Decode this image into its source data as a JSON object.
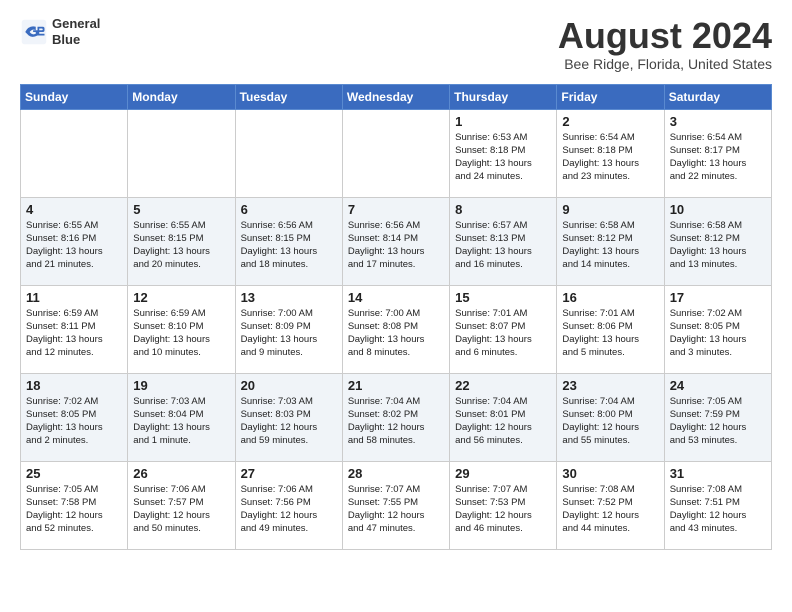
{
  "header": {
    "logo_line1": "General",
    "logo_line2": "Blue",
    "month_title": "August 2024",
    "location": "Bee Ridge, Florida, United States"
  },
  "weekdays": [
    "Sunday",
    "Monday",
    "Tuesday",
    "Wednesday",
    "Thursday",
    "Friday",
    "Saturday"
  ],
  "weeks": [
    [
      {
        "day": "",
        "info": ""
      },
      {
        "day": "",
        "info": ""
      },
      {
        "day": "",
        "info": ""
      },
      {
        "day": "",
        "info": ""
      },
      {
        "day": "1",
        "info": "Sunrise: 6:53 AM\nSunset: 8:18 PM\nDaylight: 13 hours\nand 24 minutes."
      },
      {
        "day": "2",
        "info": "Sunrise: 6:54 AM\nSunset: 8:18 PM\nDaylight: 13 hours\nand 23 minutes."
      },
      {
        "day": "3",
        "info": "Sunrise: 6:54 AM\nSunset: 8:17 PM\nDaylight: 13 hours\nand 22 minutes."
      }
    ],
    [
      {
        "day": "4",
        "info": "Sunrise: 6:55 AM\nSunset: 8:16 PM\nDaylight: 13 hours\nand 21 minutes."
      },
      {
        "day": "5",
        "info": "Sunrise: 6:55 AM\nSunset: 8:15 PM\nDaylight: 13 hours\nand 20 minutes."
      },
      {
        "day": "6",
        "info": "Sunrise: 6:56 AM\nSunset: 8:15 PM\nDaylight: 13 hours\nand 18 minutes."
      },
      {
        "day": "7",
        "info": "Sunrise: 6:56 AM\nSunset: 8:14 PM\nDaylight: 13 hours\nand 17 minutes."
      },
      {
        "day": "8",
        "info": "Sunrise: 6:57 AM\nSunset: 8:13 PM\nDaylight: 13 hours\nand 16 minutes."
      },
      {
        "day": "9",
        "info": "Sunrise: 6:58 AM\nSunset: 8:12 PM\nDaylight: 13 hours\nand 14 minutes."
      },
      {
        "day": "10",
        "info": "Sunrise: 6:58 AM\nSunset: 8:12 PM\nDaylight: 13 hours\nand 13 minutes."
      }
    ],
    [
      {
        "day": "11",
        "info": "Sunrise: 6:59 AM\nSunset: 8:11 PM\nDaylight: 13 hours\nand 12 minutes."
      },
      {
        "day": "12",
        "info": "Sunrise: 6:59 AM\nSunset: 8:10 PM\nDaylight: 13 hours\nand 10 minutes."
      },
      {
        "day": "13",
        "info": "Sunrise: 7:00 AM\nSunset: 8:09 PM\nDaylight: 13 hours\nand 9 minutes."
      },
      {
        "day": "14",
        "info": "Sunrise: 7:00 AM\nSunset: 8:08 PM\nDaylight: 13 hours\nand 8 minutes."
      },
      {
        "day": "15",
        "info": "Sunrise: 7:01 AM\nSunset: 8:07 PM\nDaylight: 13 hours\nand 6 minutes."
      },
      {
        "day": "16",
        "info": "Sunrise: 7:01 AM\nSunset: 8:06 PM\nDaylight: 13 hours\nand 5 minutes."
      },
      {
        "day": "17",
        "info": "Sunrise: 7:02 AM\nSunset: 8:05 PM\nDaylight: 13 hours\nand 3 minutes."
      }
    ],
    [
      {
        "day": "18",
        "info": "Sunrise: 7:02 AM\nSunset: 8:05 PM\nDaylight: 13 hours\nand 2 minutes."
      },
      {
        "day": "19",
        "info": "Sunrise: 7:03 AM\nSunset: 8:04 PM\nDaylight: 13 hours\nand 1 minute."
      },
      {
        "day": "20",
        "info": "Sunrise: 7:03 AM\nSunset: 8:03 PM\nDaylight: 12 hours\nand 59 minutes."
      },
      {
        "day": "21",
        "info": "Sunrise: 7:04 AM\nSunset: 8:02 PM\nDaylight: 12 hours\nand 58 minutes."
      },
      {
        "day": "22",
        "info": "Sunrise: 7:04 AM\nSunset: 8:01 PM\nDaylight: 12 hours\nand 56 minutes."
      },
      {
        "day": "23",
        "info": "Sunrise: 7:04 AM\nSunset: 8:00 PM\nDaylight: 12 hours\nand 55 minutes."
      },
      {
        "day": "24",
        "info": "Sunrise: 7:05 AM\nSunset: 7:59 PM\nDaylight: 12 hours\nand 53 minutes."
      }
    ],
    [
      {
        "day": "25",
        "info": "Sunrise: 7:05 AM\nSunset: 7:58 PM\nDaylight: 12 hours\nand 52 minutes."
      },
      {
        "day": "26",
        "info": "Sunrise: 7:06 AM\nSunset: 7:57 PM\nDaylight: 12 hours\nand 50 minutes."
      },
      {
        "day": "27",
        "info": "Sunrise: 7:06 AM\nSunset: 7:56 PM\nDaylight: 12 hours\nand 49 minutes."
      },
      {
        "day": "28",
        "info": "Sunrise: 7:07 AM\nSunset: 7:55 PM\nDaylight: 12 hours\nand 47 minutes."
      },
      {
        "day": "29",
        "info": "Sunrise: 7:07 AM\nSunset: 7:53 PM\nDaylight: 12 hours\nand 46 minutes."
      },
      {
        "day": "30",
        "info": "Sunrise: 7:08 AM\nSunset: 7:52 PM\nDaylight: 12 hours\nand 44 minutes."
      },
      {
        "day": "31",
        "info": "Sunrise: 7:08 AM\nSunset: 7:51 PM\nDaylight: 12 hours\nand 43 minutes."
      }
    ]
  ]
}
